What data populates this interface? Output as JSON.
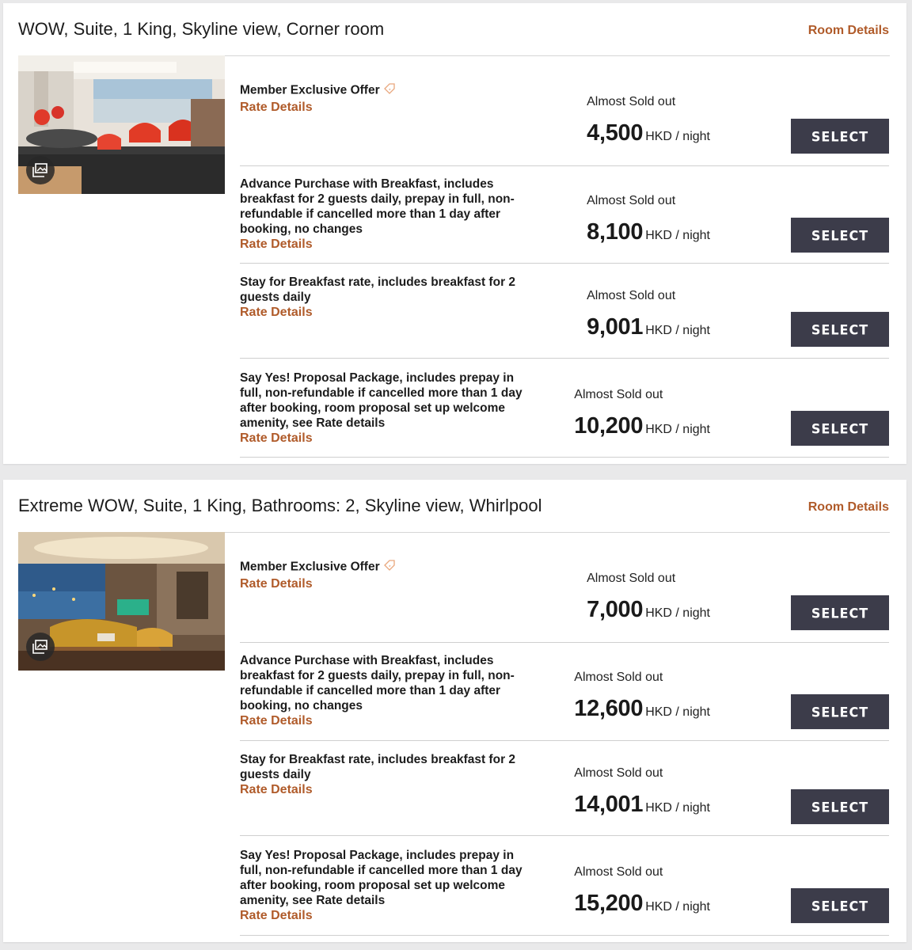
{
  "rooms": [
    {
      "title": "WOW, Suite, 1 King, Skyline view, Corner room",
      "room_details_label": "Room Details",
      "photo": "suite-living-room-photo",
      "rates": [
        {
          "desc": "Member Exclusive Offer",
          "member": true,
          "link": "Rate Details",
          "availability": "Almost Sold out",
          "price": "4,500",
          "unit": "HKD / night",
          "select": "SELECT"
        },
        {
          "desc": "Advance Purchase with Breakfast, includes breakfast for 2 guests daily, prepay in full, non-refundable if cancelled more than 1 day after booking, no changes",
          "member": false,
          "link": "Rate Details",
          "availability": "Almost Sold out",
          "price": "8,100",
          "unit": "HKD / night",
          "select": "SELECT"
        },
        {
          "desc": "Stay for Breakfast rate, includes breakfast for 2 guests daily",
          "member": false,
          "link": "Rate Details",
          "availability": "Almost Sold out",
          "price": "9,001",
          "unit": "HKD / night",
          "select": "SELECT"
        },
        {
          "desc": "Say Yes! Proposal Package, includes prepay in full, non-refundable if cancelled more than 1 day after booking, room proposal set up welcome amenity, see Rate details",
          "member": false,
          "link": "Rate Details",
          "availability": "Almost Sold out",
          "price": "10,200",
          "unit": "HKD / night",
          "select": "SELECT"
        }
      ]
    },
    {
      "title": "Extreme WOW, Suite, 1 King, Bathrooms: 2, Skyline view, Whirlpool",
      "room_details_label": "Room Details",
      "photo": "extreme-suite-photo",
      "rates": [
        {
          "desc": "Member Exclusive Offer",
          "member": true,
          "link": "Rate Details",
          "availability": "Almost Sold out",
          "price": "7,000",
          "unit": "HKD / night",
          "select": "SELECT"
        },
        {
          "desc": "Advance Purchase with Breakfast, includes breakfast for 2 guests daily, prepay in full, non-refundable if cancelled more than 1 day after booking, no changes",
          "member": false,
          "link": "Rate Details",
          "availability": "Almost Sold out",
          "price": "12,600",
          "unit": "HKD / night",
          "select": "SELECT"
        },
        {
          "desc": "Stay for Breakfast rate, includes breakfast for 2 guests daily",
          "member": false,
          "link": "Rate Details",
          "availability": "Almost Sold out",
          "price": "14,001",
          "unit": "HKD / night",
          "select": "SELECT"
        },
        {
          "desc": "Say Yes! Proposal Package, includes prepay in full, non-refundable if cancelled more than 1 day after booking, room proposal set up welcome amenity, see Rate details",
          "member": false,
          "link": "Rate Details",
          "availability": "Almost Sold out",
          "price": "15,200",
          "unit": "HKD / night",
          "select": "SELECT"
        }
      ]
    }
  ],
  "colors": {
    "accent": "#b05b2a",
    "button": "#3c3c4a",
    "divider": "#cfcfcf"
  }
}
